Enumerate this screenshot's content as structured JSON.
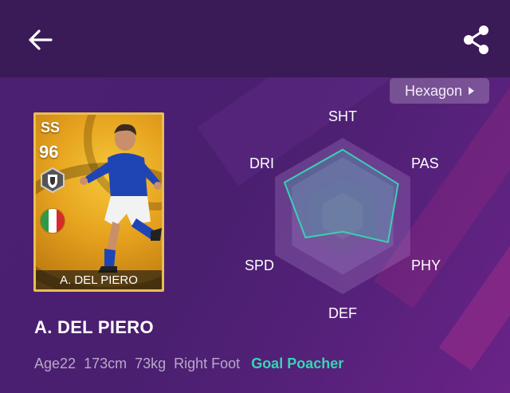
{
  "header": {
    "back_icon": "arrow-left-icon",
    "share_icon": "share-icon"
  },
  "view_toggle": {
    "label": "Hexagon",
    "icon": "triangle-right-icon"
  },
  "card": {
    "rank": "SS",
    "rating": "96",
    "name": "A. DEL PIERO",
    "badge_icon": "club-badge-icon",
    "flag_icon": "italy-flag-icon",
    "frame_color": "#e9bd52",
    "flag_colors": [
      "#2e9a48",
      "#ffffff",
      "#d52b2b"
    ]
  },
  "player": {
    "name": "A. DEL PIERO",
    "age": "Age22",
    "height": "173cm",
    "weight": "73kg",
    "foot": "Right Foot",
    "play_style": "Goal Poacher",
    "play_style_color": "#36d5b3"
  },
  "radar": {
    "labels": {
      "sht": "SHT",
      "pas": "PAS",
      "phy": "PHY",
      "def": "DEF",
      "spd": "SPD",
      "dri": "DRI"
    },
    "stat_fractions": {
      "sht": 0.85,
      "pas": 0.82,
      "phy": 0.67,
      "def": 0.2,
      "spd": 0.55,
      "dri": 0.86
    },
    "outline_color": "#3ad0b4"
  }
}
